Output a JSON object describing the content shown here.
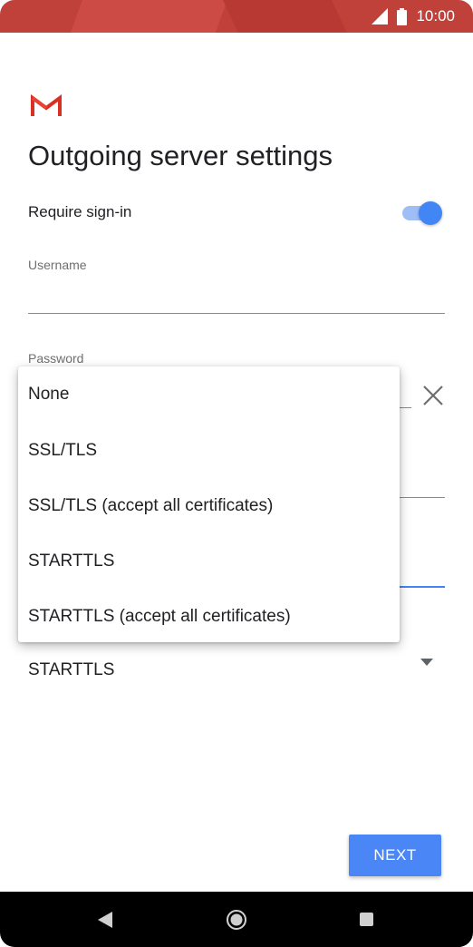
{
  "status_bar": {
    "time": "10:00",
    "icons": [
      "signal-icon",
      "battery-icon"
    ]
  },
  "app": {
    "logo": "gmail-logo",
    "title": "Outgoing server settings"
  },
  "form": {
    "require_signin_label": "Require sign-in",
    "require_signin_on": true,
    "username_label": "Username",
    "username_value": "",
    "password_label": "Password",
    "security_type_value": "STARTTLS"
  },
  "dropdown": {
    "options": [
      "None",
      "SSL/TLS",
      "SSL/TLS (accept all certificates)",
      "STARTTLS",
      "STARTTLS (accept all certificates)"
    ]
  },
  "buttons": {
    "next_label": "NEXT"
  },
  "colors": {
    "status_bar": "#c0403a",
    "accent": "#4285f4",
    "button": "#4a86f5"
  }
}
